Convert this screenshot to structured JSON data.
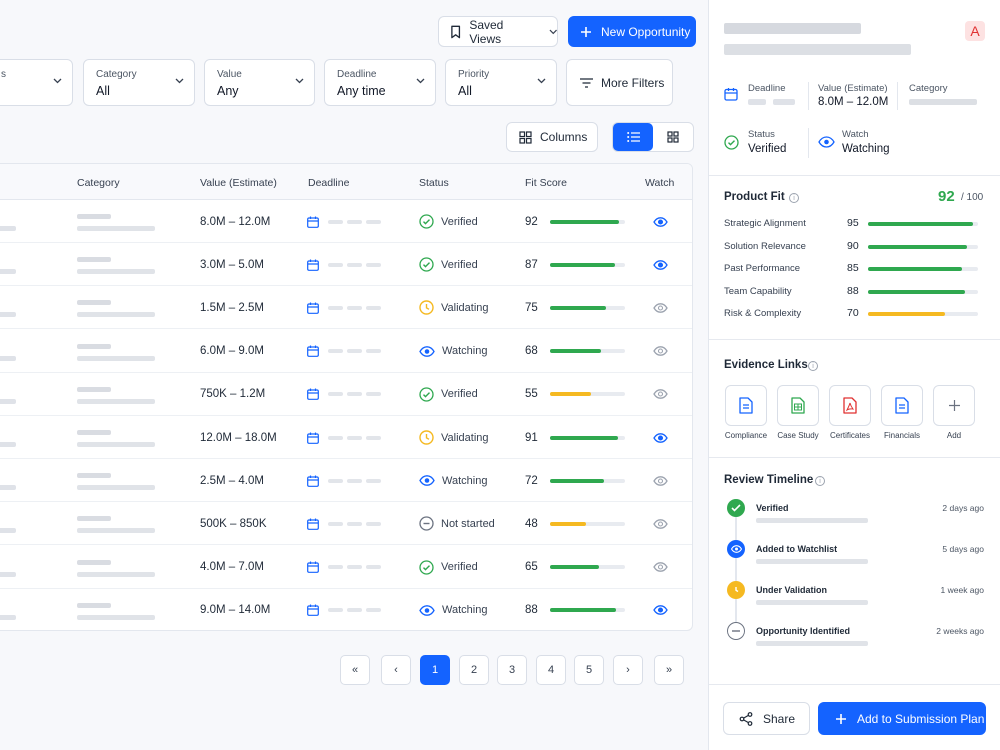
{
  "toolbar": {
    "saved_views_label": "Saved Views",
    "new_opportunity_label": "New Opportunity",
    "columns_label": "Columns",
    "more_filters_label": "More Filters"
  },
  "filters": [
    {
      "label": "Category",
      "value": "All"
    },
    {
      "label": "Value",
      "value": "Any"
    },
    {
      "label": "Deadline",
      "value": "Any time"
    },
    {
      "label": "Priority",
      "value": "All"
    }
  ],
  "table": {
    "headers": {
      "category": "Category",
      "value": "Value (Estimate)",
      "deadline": "Deadline",
      "status": "Status",
      "fit_score": "Fit Score",
      "watch": "Watch"
    },
    "rows": [
      {
        "value": "8.0M – 12.0M",
        "status": "Verified",
        "score": "92",
        "fit": 0.92,
        "watched": true
      },
      {
        "value": "3.0M – 5.0M",
        "status": "Verified",
        "score": "87",
        "fit": 0.87,
        "watched": true
      },
      {
        "value": "1.5M – 2.5M",
        "status": "Validating",
        "score": "75",
        "fit": 0.75,
        "watched": false
      },
      {
        "value": "6.0M – 9.0M",
        "status": "Watching",
        "score": "68",
        "fit": 0.68,
        "watched": false
      },
      {
        "value": "750K – 1.2M",
        "status": "Verified",
        "score": "55",
        "fit": 0.55,
        "watched": false
      },
      {
        "value": "12.0M – 18.0M",
        "status": "Validating",
        "score": "91",
        "fit": 0.91,
        "watched": true
      },
      {
        "value": "2.5M – 4.0M",
        "status": "Watching",
        "score": "72",
        "fit": 0.72,
        "watched": false
      },
      {
        "value": "500K – 850K",
        "status": "Not started",
        "score": "48",
        "fit": 0.48,
        "watched": false
      },
      {
        "value": "4.0M – 7.0M",
        "status": "Verified",
        "score": "65",
        "fit": 0.65,
        "watched": false
      },
      {
        "value": "9.0M – 14.0M",
        "status": "Watching",
        "score": "88",
        "fit": 0.88,
        "watched": true
      }
    ]
  },
  "pagination": {
    "first": "«",
    "prev": "‹",
    "pages": [
      "1",
      "2",
      "3",
      "4",
      "5"
    ],
    "current": "1",
    "next": "›",
    "last": "»"
  },
  "detail": {
    "badge": "A",
    "meta": {
      "deadline_label": "Deadline",
      "value_label": "Value (Estimate)",
      "value": "8.0M – 12.0M",
      "category_label": "Category",
      "status_label": "Status",
      "status": "Verified",
      "watch_label": "Watch",
      "watch": "Watching"
    },
    "product_fit": {
      "title": "Product Fit",
      "score": "92",
      "max": "/ 100",
      "criteria": [
        {
          "label": "Strategic Alignment",
          "score": "95",
          "level": 0.95
        },
        {
          "label": "Solution Relevance",
          "score": "90",
          "level": 0.9
        },
        {
          "label": "Past Performance",
          "score": "85",
          "level": 0.85
        },
        {
          "label": "Team Capability",
          "score": "88",
          "level": 0.88
        },
        {
          "label": "Risk & Complexity",
          "score": "70",
          "level": 0.7
        }
      ]
    },
    "evidence": {
      "title": "Evidence Links",
      "items": [
        {
          "label": "Compliance"
        },
        {
          "label": "Case Study"
        },
        {
          "label": "Certificates"
        },
        {
          "label": "Financials"
        },
        {
          "label": "Add"
        }
      ]
    },
    "timeline": {
      "title": "Review Timeline",
      "events": [
        {
          "title": "Verified",
          "time": "2 days ago"
        },
        {
          "title": "Added to Watchlist",
          "time": "5 days ago"
        },
        {
          "title": "Under Validation",
          "time": "1 week ago"
        },
        {
          "title": "Opportunity Identified",
          "time": "2 weeks ago"
        }
      ]
    },
    "share_label": "Share",
    "add_plan_label": "Add to Submission Plan"
  },
  "colors": {
    "primary": "#1463ff",
    "success": "#2fa84f",
    "warning": "#f5b921",
    "danger": "#e03131"
  }
}
